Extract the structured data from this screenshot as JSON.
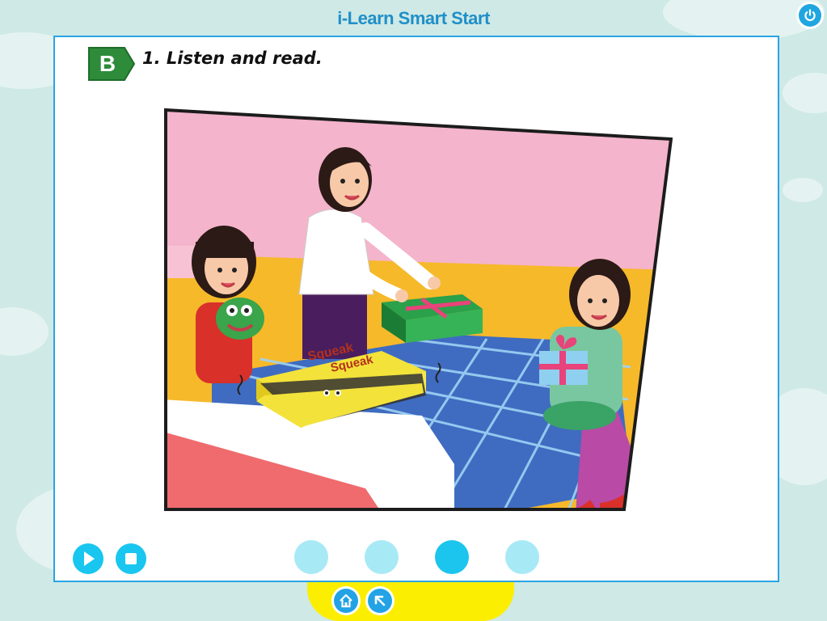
{
  "app": {
    "title": "i-Learn Smart Start"
  },
  "section": {
    "badge": "B",
    "heading": "1. Listen and read."
  },
  "illustration": {
    "box_text_line1": "Squeak",
    "box_text_line2": "Squeak"
  },
  "controls": {
    "play_icon": "play-icon",
    "stop_icon": "stop-icon"
  },
  "pager": {
    "count": 4,
    "active_index": 3
  },
  "dock": {
    "home_icon": "home-icon",
    "back_icon": "back-arrow-icon"
  },
  "colors": {
    "accent_blue": "#1fa6e0",
    "title_blue": "#1f8fc8",
    "badge_green": "#2e8b3a",
    "dock_yellow": "#fcee00",
    "dot_active": "#1cc5ee",
    "dot_inactive": "#a8e9f6"
  }
}
